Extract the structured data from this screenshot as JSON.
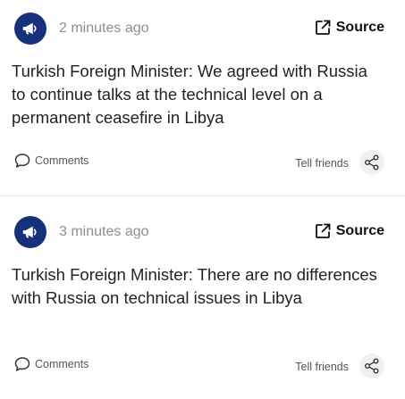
{
  "brand_color": "#16307a",
  "posts": [
    {
      "avatar_icon": "megaphone-icon",
      "time": "2 minutes ago",
      "source_label": "Source",
      "source_icon": "external-link-icon",
      "headline": "Turkish Foreign Minister: We agreed with Russia to continue talks at the technical level on a permanent ceasefire in Libya",
      "comments_label": "Comments",
      "comments_icon": "comment-bubble-icon",
      "tell_friends_label": "Tell friends",
      "share_icon": "share-icon"
    },
    {
      "avatar_icon": "megaphone-icon",
      "time": "3 minutes ago",
      "source_label": "Source",
      "source_icon": "external-link-icon",
      "headline": "Turkish Foreign Minister: There are no differences with Russia on technical issues in Libya",
      "comments_label": "Comments",
      "comments_icon": "comment-bubble-icon",
      "tell_friends_label": "Tell friends",
      "share_icon": "share-icon"
    }
  ]
}
